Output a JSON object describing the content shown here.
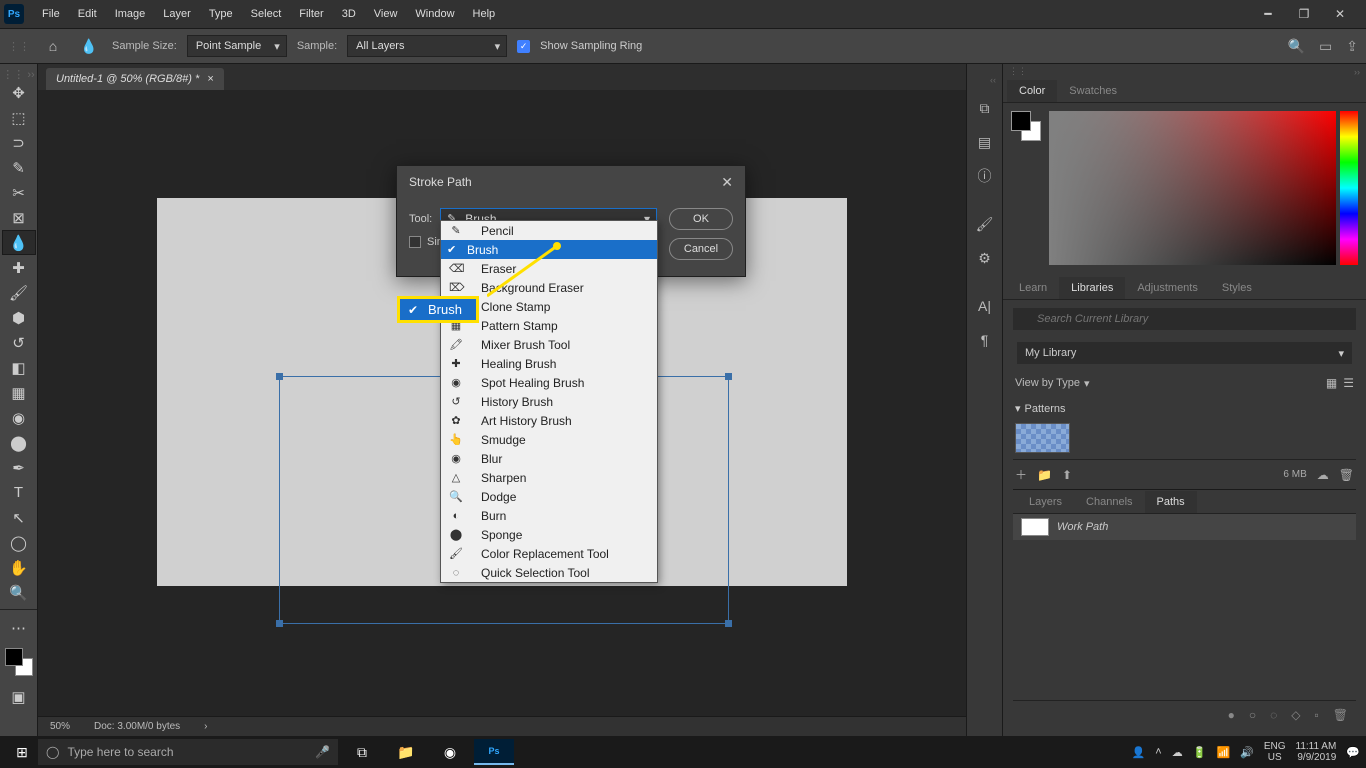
{
  "app": {
    "logo": "Ps"
  },
  "menu": [
    "File",
    "Edit",
    "Image",
    "Layer",
    "Type",
    "Select",
    "Filter",
    "3D",
    "View",
    "Window",
    "Help"
  ],
  "options": {
    "sample_size_label": "Sample Size:",
    "sample_size_value": "Point Sample",
    "sample_label": "Sample:",
    "sample_value": "All Layers",
    "show_ring": "Show Sampling Ring"
  },
  "doc": {
    "tab": "Untitled-1 @ 50% (RGB/8#) *"
  },
  "dialog": {
    "title": "Stroke Path",
    "tool_label": "Tool:",
    "selected_tool": "Brush",
    "simulate": "Simulate Pressure",
    "ok": "OK",
    "cancel": "Cancel"
  },
  "tool_list": [
    "Pencil",
    "Brush",
    "Eraser",
    "Background Eraser",
    "Clone Stamp",
    "Pattern Stamp",
    "Mixer Brush Tool",
    "Healing Brush",
    "Spot Healing Brush",
    "History Brush",
    "Art History Brush",
    "Smudge",
    "Blur",
    "Sharpen",
    "Dodge",
    "Burn",
    "Sponge",
    "Color Replacement Tool",
    "Quick Selection Tool"
  ],
  "tool_selected_index": 1,
  "callout": "Brush",
  "panels": {
    "color_tabs": [
      "Color",
      "Swatches"
    ],
    "lib_tabs": [
      "Learn",
      "Libraries",
      "Adjustments",
      "Styles"
    ],
    "search_ph": "Search Current Library",
    "my_library": "My Library",
    "view_by": "View by Type",
    "patterns": "Patterns",
    "size": "6 MB",
    "layer_tabs": [
      "Layers",
      "Channels",
      "Paths"
    ],
    "work_path": "Work Path"
  },
  "status": {
    "zoom": "50%",
    "doc": "Doc: 3.00M/0 bytes"
  },
  "taskbar": {
    "search": "Type here to search",
    "lang": "ENG",
    "locale": "US",
    "time": "11:11 AM",
    "date": "9/9/2019"
  }
}
